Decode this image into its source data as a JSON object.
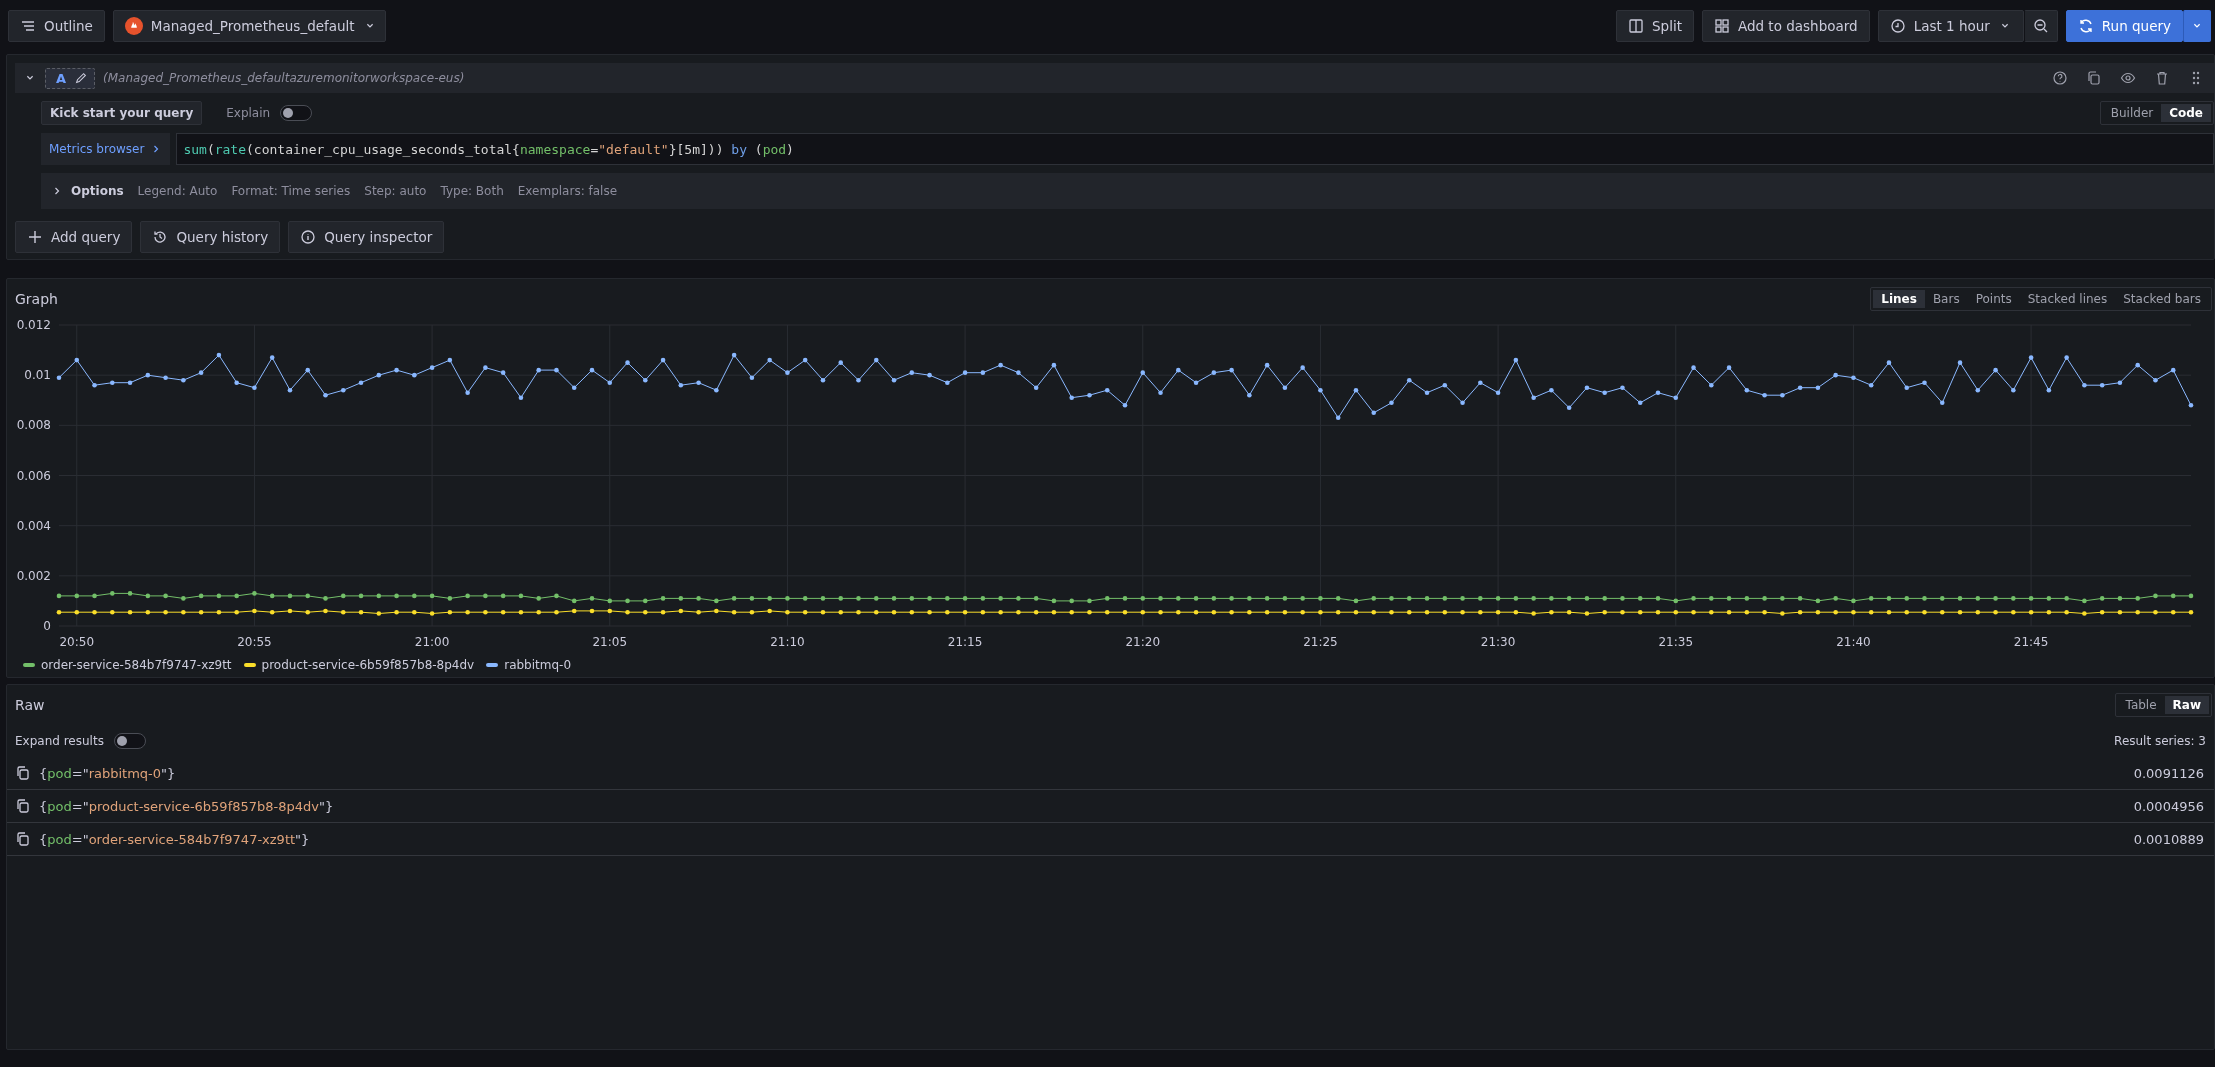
{
  "toolbar": {
    "outline": "Outline",
    "datasource": "Managed_Prometheus_default",
    "split": "Split",
    "add_to_dashboard": "Add to dashboard",
    "time_range": "Last 1 hour",
    "run_query": "Run query"
  },
  "query": {
    "ref": "A",
    "expanded": true,
    "datasource": "(Managed_Prometheus_defaultazuremonitorworkspace-eus)",
    "kick_start": "Kick start your query",
    "explain": {
      "label": "Explain",
      "on": false
    },
    "modes": [
      {
        "label": "Builder",
        "selected": false
      },
      {
        "label": "Code",
        "selected": true
      }
    ],
    "metrics_browser": "Metrics browser",
    "tokens": [
      {
        "kind": "func",
        "text": "sum"
      },
      {
        "kind": "plain",
        "text": "("
      },
      {
        "kind": "func",
        "text": "rate"
      },
      {
        "kind": "plain",
        "text": "(container_cpu_usage_seconds_total{"
      },
      {
        "kind": "label",
        "text": "namespace"
      },
      {
        "kind": "plain",
        "text": "="
      },
      {
        "kind": "string",
        "text": "\"default\""
      },
      {
        "kind": "plain",
        "text": "}[5m])) "
      },
      {
        "kind": "keyword",
        "text": "by"
      },
      {
        "kind": "plain",
        "text": " ("
      },
      {
        "kind": "label",
        "text": "pod"
      },
      {
        "kind": "plain",
        "text": ")"
      }
    ],
    "options": {
      "label": "Options",
      "expanded": false,
      "items": [
        "Legend: Auto",
        "Format: Time series",
        "Step: auto",
        "Type: Both",
        "Exemplars: false"
      ]
    }
  },
  "actions": [
    {
      "kind": "add",
      "label": "Add query"
    },
    {
      "kind": "history",
      "label": "Query history"
    },
    {
      "kind": "inspector",
      "label": "Query inspector"
    }
  ],
  "graph": {
    "title": "Graph",
    "styles": [
      {
        "label": "Lines",
        "selected": true
      },
      {
        "label": "Bars",
        "selected": false
      },
      {
        "label": "Points",
        "selected": false
      },
      {
        "label": "Stacked lines",
        "selected": false
      },
      {
        "label": "Stacked bars",
        "selected": false
      }
    ],
    "chart_data": {
      "type": "line",
      "grid": true,
      "categories": [
        null,
        "20:50",
        null,
        null,
        null,
        null,
        null,
        null,
        null,
        null,
        null,
        "20:55",
        null,
        null,
        null,
        null,
        null,
        null,
        null,
        null,
        null,
        "21:00",
        null,
        null,
        null,
        null,
        null,
        null,
        null,
        null,
        null,
        "21:05",
        null,
        null,
        null,
        null,
        null,
        null,
        null,
        null,
        null,
        "21:10",
        null,
        null,
        null,
        null,
        null,
        null,
        null,
        null,
        null,
        "21:15",
        null,
        null,
        null,
        null,
        null,
        null,
        null,
        null,
        null,
        "21:20",
        null,
        null,
        null,
        null,
        null,
        null,
        null,
        null,
        null,
        "21:25",
        null,
        null,
        null,
        null,
        null,
        null,
        null,
        null,
        null,
        "21:30",
        null,
        null,
        null,
        null,
        null,
        null,
        null,
        null,
        null,
        "21:35",
        null,
        null,
        null,
        null,
        null,
        null,
        null,
        null,
        null,
        "21:40",
        null,
        null,
        null,
        null,
        null,
        null,
        null,
        null,
        null,
        "21:45",
        null,
        null,
        null,
        null,
        null,
        null,
        null,
        null,
        null
      ],
      "ylim": [
        0,
        0.012
      ],
      "yticks": [
        0,
        0.002,
        0.004,
        0.006,
        0.008,
        0.01,
        0.012
      ],
      "series": [
        {
          "name": "order-service-584b7f9747-xz9tt",
          "color": "#73bf69",
          "values": [
            0.0012,
            0.0012,
            0.0012,
            0.0013,
            0.0013,
            0.0012,
            0.0012,
            0.0011,
            0.0012,
            0.0012,
            0.0012,
            0.0013,
            0.0012,
            0.0012,
            0.0012,
            0.0011,
            0.0012,
            0.0012,
            0.0012,
            0.0012,
            0.0012,
            0.0012,
            0.0011,
            0.0012,
            0.0012,
            0.0012,
            0.0012,
            0.0011,
            0.0012,
            0.001,
            0.0011,
            0.001,
            0.001,
            0.001,
            0.0011,
            0.0011,
            0.0011,
            0.001,
            0.0011,
            0.0011,
            0.0011,
            0.0011,
            0.0011,
            0.0011,
            0.0011,
            0.0011,
            0.0011,
            0.0011,
            0.0011,
            0.0011,
            0.0011,
            0.0011,
            0.0011,
            0.0011,
            0.0011,
            0.0011,
            0.001,
            0.001,
            0.001,
            0.0011,
            0.0011,
            0.0011,
            0.0011,
            0.0011,
            0.0011,
            0.0011,
            0.0011,
            0.0011,
            0.0011,
            0.0011,
            0.0011,
            0.0011,
            0.0011,
            0.001,
            0.0011,
            0.0011,
            0.0011,
            0.0011,
            0.0011,
            0.0011,
            0.0011,
            0.0011,
            0.0011,
            0.0011,
            0.0011,
            0.0011,
            0.0011,
            0.0011,
            0.0011,
            0.0011,
            0.0011,
            0.001,
            0.0011,
            0.0011,
            0.0011,
            0.0011,
            0.0011,
            0.0011,
            0.0011,
            0.001,
            0.0011,
            0.001,
            0.0011,
            0.0011,
            0.0011,
            0.0011,
            0.0011,
            0.0011,
            0.0011,
            0.0011,
            0.0011,
            0.0011,
            0.0011,
            0.0011,
            0.001,
            0.0011,
            0.0011,
            0.0011,
            0.0012,
            0.0012,
            0.0012
          ]
        },
        {
          "name": "product-service-6b59f857b8-8p4dv",
          "color": "#fade2a",
          "values": [
            0.00055,
            0.00055,
            0.00055,
            0.00055,
            0.00055,
            0.00055,
            0.00055,
            0.00055,
            0.00055,
            0.00055,
            0.00055,
            0.0006,
            0.00055,
            0.0006,
            0.00055,
            0.0006,
            0.00055,
            0.00055,
            0.0005,
            0.00055,
            0.00055,
            0.0005,
            0.00055,
            0.00055,
            0.00055,
            0.00055,
            0.00055,
            0.00055,
            0.00055,
            0.0006,
            0.0006,
            0.0006,
            0.00055,
            0.00055,
            0.00055,
            0.0006,
            0.00055,
            0.0006,
            0.00055,
            0.00055,
            0.0006,
            0.00055,
            0.00055,
            0.00055,
            0.00055,
            0.00055,
            0.00055,
            0.00055,
            0.00055,
            0.00055,
            0.00055,
            0.00055,
            0.00055,
            0.00055,
            0.00055,
            0.00055,
            0.00055,
            0.00055,
            0.00055,
            0.00055,
            0.00055,
            0.00055,
            0.00055,
            0.00055,
            0.00055,
            0.00055,
            0.00055,
            0.00055,
            0.00055,
            0.00055,
            0.00055,
            0.00055,
            0.00055,
            0.00055,
            0.00055,
            0.00055,
            0.00055,
            0.00055,
            0.00055,
            0.00055,
            0.00055,
            0.00055,
            0.00055,
            0.0005,
            0.00055,
            0.00055,
            0.0005,
            0.00055,
            0.00055,
            0.00055,
            0.00055,
            0.00055,
            0.00055,
            0.00055,
            0.00055,
            0.00055,
            0.00055,
            0.0005,
            0.00055,
            0.00055,
            0.00055,
            0.00055,
            0.00055,
            0.00055,
            0.00055,
            0.00055,
            0.00055,
            0.00055,
            0.00055,
            0.00055,
            0.00055,
            0.00055,
            0.00055,
            0.00055,
            0.0005,
            0.00055,
            0.00055,
            0.00055,
            0.00055,
            0.00055,
            0.00055
          ]
        },
        {
          "name": "rabbitmq-0",
          "color": "#8ab8ff",
          "values": [
            0.0099,
            0.0106,
            0.0096,
            0.0097,
            0.0097,
            0.01,
            0.0099,
            0.0098,
            0.0101,
            0.0108,
            0.0097,
            0.0095,
            0.0107,
            0.0094,
            0.0102,
            0.0092,
            0.0094,
            0.0097,
            0.01,
            0.0102,
            0.01,
            0.0103,
            0.0106,
            0.0093,
            0.0103,
            0.0101,
            0.0091,
            0.0102,
            0.0102,
            0.0095,
            0.0102,
            0.0097,
            0.0105,
            0.0098,
            0.0106,
            0.0096,
            0.0097,
            0.0094,
            0.0108,
            0.0099,
            0.0106,
            0.0101,
            0.0106,
            0.0098,
            0.0105,
            0.0098,
            0.0106,
            0.0098,
            0.0101,
            0.01,
            0.0097,
            0.0101,
            0.0101,
            0.0104,
            0.0101,
            0.0095,
            0.0104,
            0.0091,
            0.0092,
            0.0094,
            0.0088,
            0.0101,
            0.0093,
            0.0102,
            0.0097,
            0.0101,
            0.0102,
            0.0092,
            0.0104,
            0.0095,
            0.0103,
            0.0094,
            0.0083,
            0.0094,
            0.0085,
            0.0089,
            0.0098,
            0.0093,
            0.0096,
            0.0089,
            0.0097,
            0.0093,
            0.0106,
            0.0091,
            0.0094,
            0.0087,
            0.0095,
            0.0093,
            0.0095,
            0.0089,
            0.0093,
            0.0091,
            0.0103,
            0.0096,
            0.0103,
            0.0094,
            0.0092,
            0.0092,
            0.0095,
            0.0095,
            0.01,
            0.0099,
            0.0096,
            0.0105,
            0.0095,
            0.0097,
            0.0089,
            0.0105,
            0.0094,
            0.0102,
            0.0094,
            0.0107,
            0.0094,
            0.0107,
            0.0096,
            0.0096,
            0.0097,
            0.0104,
            0.0098,
            0.0102,
            0.0088
          ]
        }
      ]
    }
  },
  "raw": {
    "title": "Raw",
    "views": [
      {
        "label": "Table",
        "selected": false
      },
      {
        "label": "Raw",
        "selected": true
      }
    ],
    "expand": {
      "label": "Expand results",
      "on": false
    },
    "result_count": "Result series: 3",
    "results": [
      {
        "parts": [
          {
            "kind": "punct",
            "text": "{"
          },
          {
            "kind": "label",
            "text": "pod"
          },
          {
            "kind": "punct",
            "text": "=\""
          },
          {
            "kind": "string",
            "text": "rabbitmq-0"
          },
          {
            "kind": "punct",
            "text": "\"}"
          }
        ],
        "value": "0.0091126"
      },
      {
        "parts": [
          {
            "kind": "punct",
            "text": "{"
          },
          {
            "kind": "label",
            "text": "pod"
          },
          {
            "kind": "punct",
            "text": "=\""
          },
          {
            "kind": "string",
            "text": "product-service-6b59f857b8-8p4dv"
          },
          {
            "kind": "punct",
            "text": "\"}"
          }
        ],
        "value": "0.0004956"
      },
      {
        "parts": [
          {
            "kind": "punct",
            "text": "{"
          },
          {
            "kind": "label",
            "text": "pod"
          },
          {
            "kind": "punct",
            "text": "=\""
          },
          {
            "kind": "string",
            "text": "order-service-584b7f9747-xz9tt"
          },
          {
            "kind": "punct",
            "text": "\"}"
          }
        ],
        "value": "0.0010889"
      }
    ]
  }
}
